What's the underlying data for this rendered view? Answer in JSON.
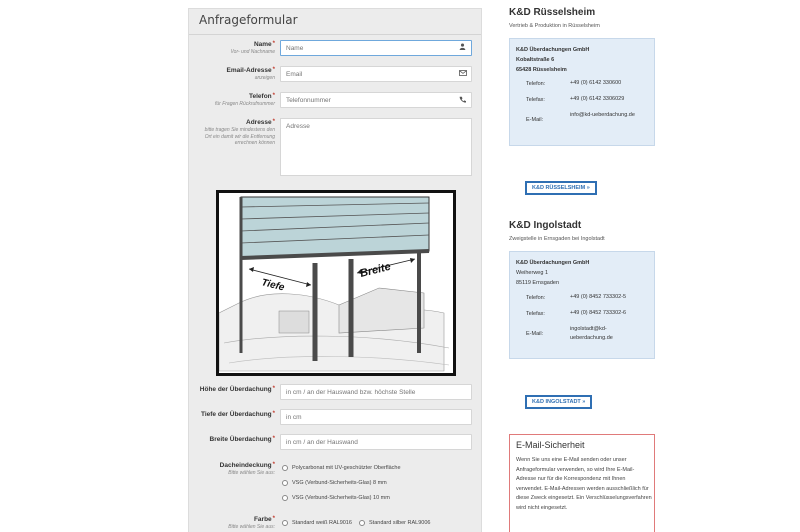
{
  "form": {
    "title": "Anfrageformular",
    "name": {
      "label": "Name",
      "sub": "Vor- und Nachname",
      "placeholder": "Name"
    },
    "email": {
      "label": "Email-Adresse",
      "sub": "anzeigen",
      "placeholder": "Email"
    },
    "telefon": {
      "label": "Telefon",
      "sub": "für Fragen Rückrufnummer",
      "placeholder": "Telefonnummer"
    },
    "adresse": {
      "label": "Adresse",
      "sub": "bitte tragen Sie mindestens den Ort ein damit wir die Entfernung errechnen können",
      "placeholder": "Adresse"
    },
    "illustration": {
      "tiefe_label": "Tiefe",
      "breite_label": "Breite"
    },
    "hoehe": {
      "label": "Höhe der Überdachung",
      "placeholder": "in cm / an der Hauswand bzw. höchste Stelle"
    },
    "tiefe": {
      "label": "Tiefe der Überdachung",
      "placeholder": "in cm"
    },
    "breite": {
      "label": "Breite Überdachung",
      "placeholder": "in cm / an der Hauswand"
    },
    "dacheindeckung": {
      "label": "Dacheindeckung",
      "sub": "Bitte wählen Sie aus:",
      "options": [
        "Polycarbonat mit UV-geschützter Oberfläche",
        "VSG (Verbund-Sicherheits-Glas) 8 mm",
        "VSG (Verbund-Sicherheits-Glas) 10 mm"
      ]
    },
    "farbe": {
      "label": "Farbe",
      "sub": "Bitte wählen Sie aus:",
      "options": [
        "Standard weiß RAL9016",
        "Standard silber RAL9006"
      ]
    }
  },
  "locations": [
    {
      "title": "K&D Rüsselsheim",
      "subtitle": "Vertrieb & Produktion in Rüsselsheim",
      "company": "K&D Überdachungen GmbH",
      "street": "Kobaltstraße 6",
      "city": "65428 Rüsselsheim",
      "phone_label": "Telefon:",
      "phone": "+49 (0) 6142 330600",
      "fax_label": "Telefax:",
      "fax": "+49 (0) 6142 3306029",
      "email_label": "E-Mail:",
      "email": "info@kd-ueberdachung.de",
      "button": "K&D RÜSSELSHEIM »"
    },
    {
      "title": "K&D Ingolstadt",
      "subtitle": "Zweigstelle in Ernsgaden bei Ingolstadt",
      "company": "K&D Überdachungen GmbH",
      "street": "Weiherweg 1",
      "city": "85119 Ernsgaden",
      "phone_label": "Telefon:",
      "phone": "+49 (0) 8452 733302-5",
      "fax_label": "Telefax:",
      "fax": "+49 (0) 8452 733302-6",
      "email_label": "E-Mail:",
      "email": "ingolstadt@kd-ueberdachung.de",
      "button": "K&D INGOLSTADT »"
    }
  ],
  "security": {
    "title": "E-Mail-Sicherheit",
    "text": "Wenn Sie uns eine E-Mail senden oder unser Anfrageformular verwenden, so wird Ihre E-Mail-Adresse nur für die Korrespondenz mit Ihnen verwendet. E-Mail-Adressen werden ausschließlich für diese Zweck eingesetzt. Ein Verschlüsselungsverfahren wird nicht eingesetzt."
  },
  "icons": {
    "name": "person-icon",
    "email": "envelope-icon",
    "telefon": "phone-icon"
  },
  "colors": {
    "accent": "#2f6fb3",
    "info_box": "#e3edf7",
    "security_border": "#e07a7a",
    "required": "#c0392b"
  }
}
